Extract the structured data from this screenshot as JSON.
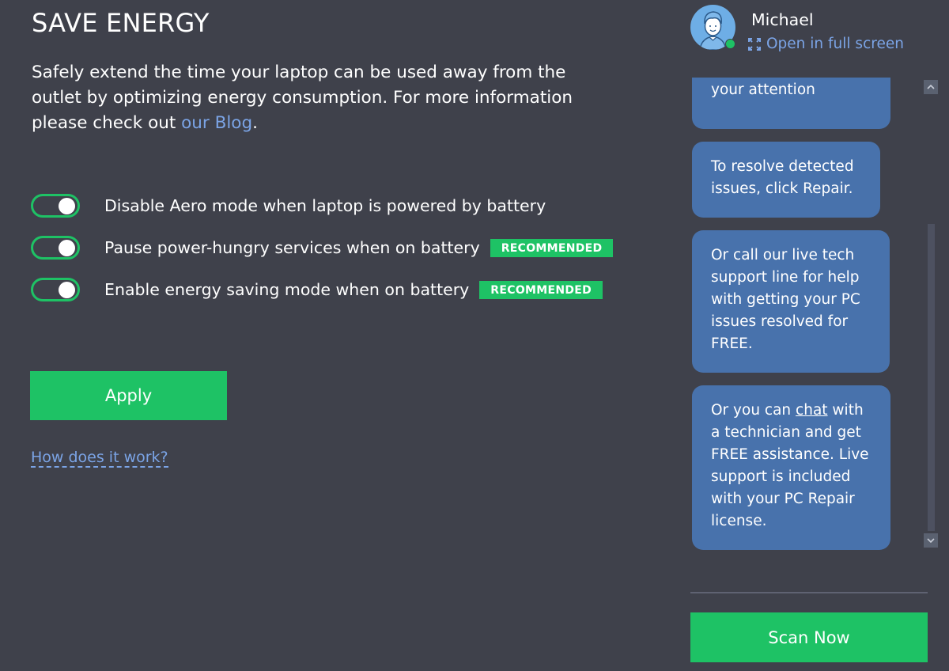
{
  "page": {
    "title": "SAVE ENERGY",
    "description_before_link": "Safely extend the time your laptop can be used away from the outlet by optimizing energy consumption. For more information please check out ",
    "description_link": "our Blog",
    "description_after_link": "."
  },
  "options": [
    {
      "label": "Disable Aero mode when laptop is powered by battery",
      "enabled": true,
      "badge": null
    },
    {
      "label": "Pause power-hungry services when on battery",
      "enabled": true,
      "badge": "RECOMMENDED"
    },
    {
      "label": "Enable energy saving mode when on battery",
      "enabled": true,
      "badge": "RECOMMENDED"
    }
  ],
  "actions": {
    "apply_label": "Apply",
    "how_link": "How does it work?"
  },
  "agent": {
    "name": "Michael",
    "status": "online",
    "fullscreen_label": "Open in full screen"
  },
  "chat": {
    "messages": [
      {
        "text": "issues that may need your attention"
      },
      {
        "text": "To resolve detected issues, click Repair."
      },
      {
        "text": "Or call our live tech support line for help with getting your PC issues resolved for FREE."
      },
      {
        "text_before": "Or you can ",
        "link": "chat",
        "text_after": " with a technician and get FREE assistance. Live support is included with your PC Repair license."
      }
    ]
  },
  "footer": {
    "scan_label": "Scan Now"
  },
  "colors": {
    "background": "#3f414b",
    "accent_green": "#1ec265",
    "link_blue": "#7ba4e6",
    "bubble_blue": "#4872ac"
  }
}
